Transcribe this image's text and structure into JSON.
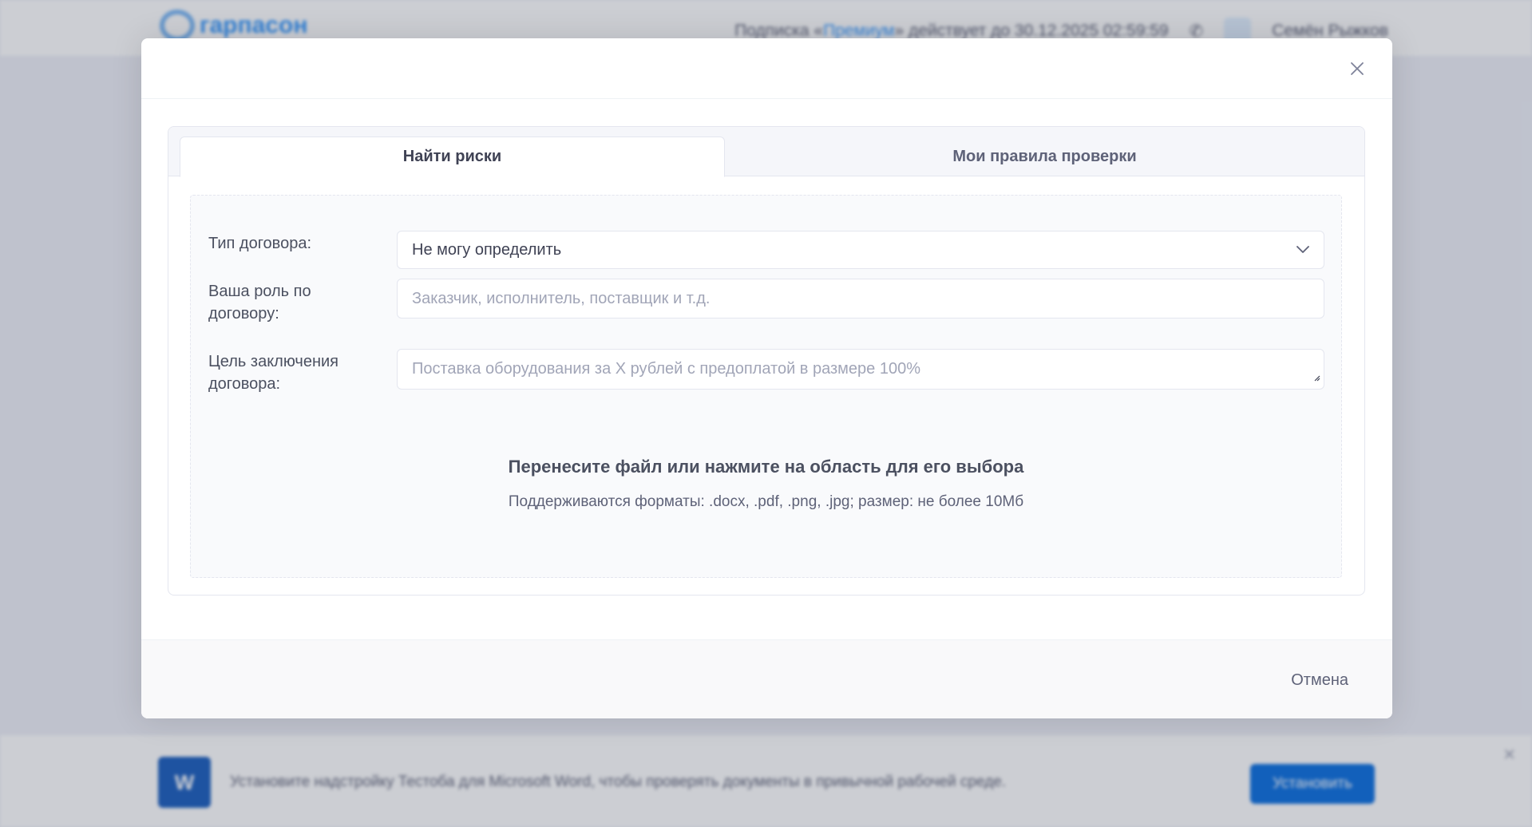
{
  "background": {
    "logo_text": "гарпасон",
    "header": {
      "subscription_prefix": "Подписка «",
      "subscription_plan": "Премиум",
      "subscription_suffix": "» действует до 30.12.2025 02:59:59",
      "user_name": "Семён Рыжков"
    },
    "bottom_banner": {
      "text": "Установите надстройку Тестоба для Microsoft Word, чтобы проверять документы в привычной рабочей среде.",
      "button_label": "Установить",
      "word_letter": "W"
    }
  },
  "modal": {
    "tabs": [
      {
        "label": "Найти риски",
        "active": true
      },
      {
        "label": "Мои правила проверки",
        "active": false
      }
    ],
    "form": {
      "contract_type": {
        "label": "Тип договора:",
        "value": "Не могу определить"
      },
      "role": {
        "label": "Ваша роль по договору:",
        "placeholder": "Заказчик, исполнитель, поставщик и т.д."
      },
      "purpose": {
        "label": "Цель заключения договора:",
        "placeholder": "Поставка оборудования за Х рублей с предоплатой в размере 100%"
      }
    },
    "dropzone": {
      "title": "Перенесите файл или нажмите на область для его выбора",
      "subtitle": "Поддерживаются форматы: .docx, .pdf, .png, .jpg; размер: не более 10Мб"
    },
    "footer": {
      "cancel_label": "Отмена"
    }
  }
}
